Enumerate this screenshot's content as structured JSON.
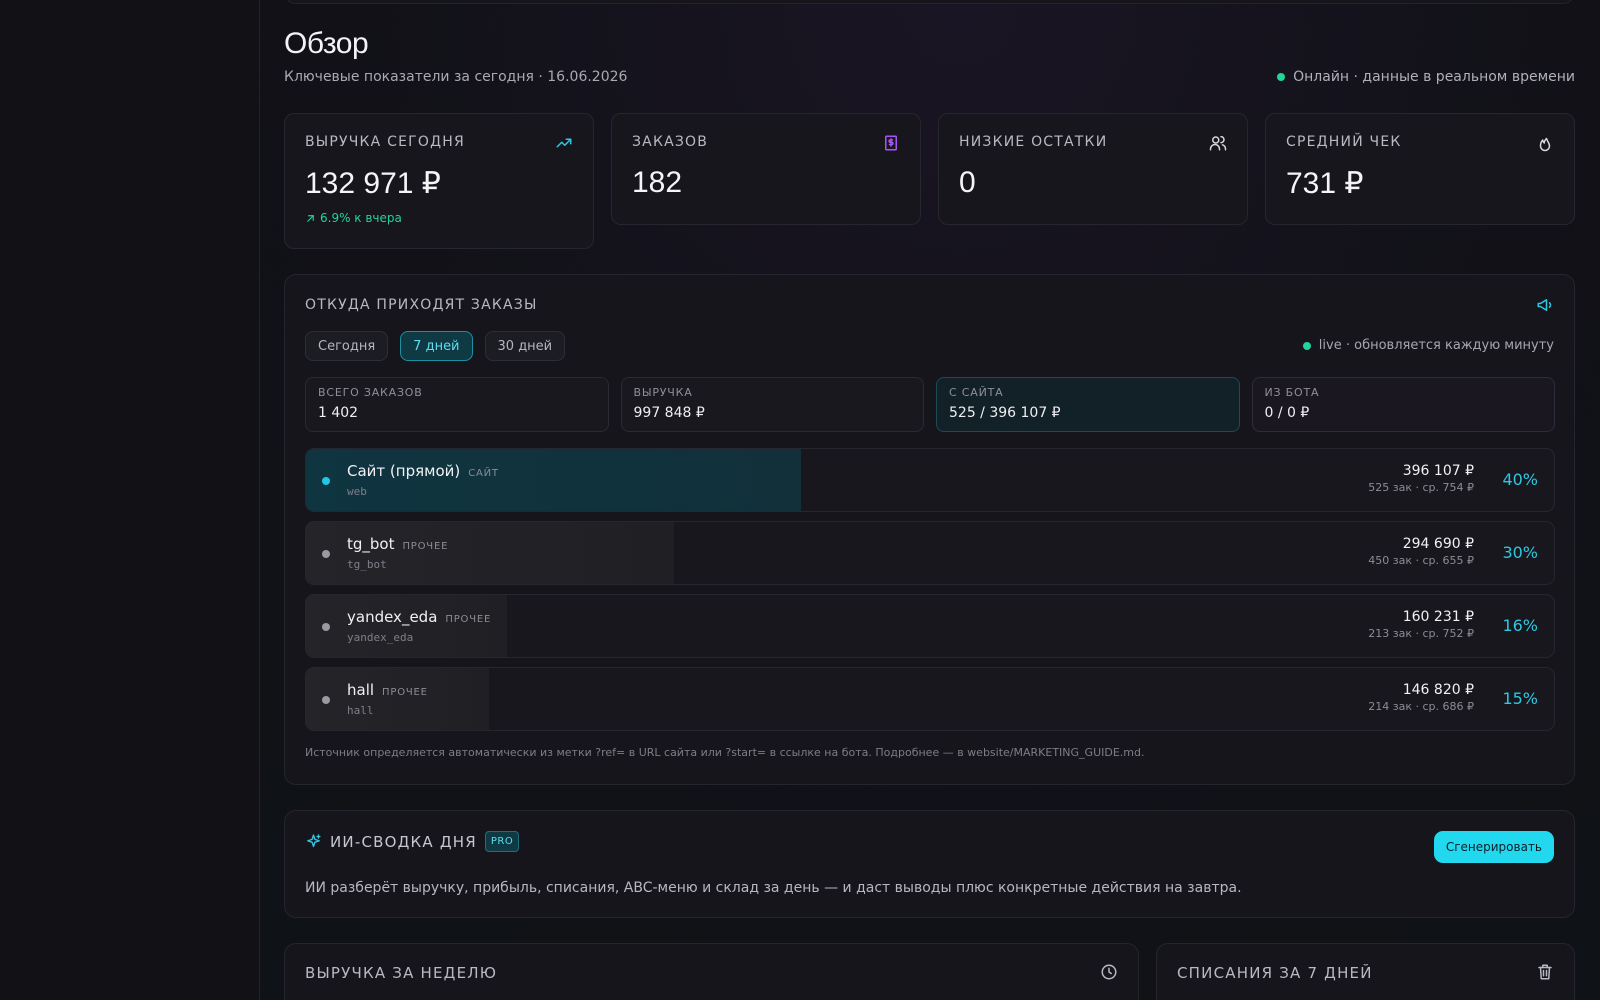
{
  "header": {
    "title": "Обзор",
    "subtitle": "Ключевые показатели за сегодня · 16.06.2026",
    "online_status": "Онлайн · данные в реальном времени"
  },
  "kpis": [
    {
      "label": "ВЫРУЧКА СЕГОДНЯ",
      "value": "132 971 ₽",
      "delta": "6.9% к вчера",
      "icon": "trending-up-icon"
    },
    {
      "label": "ЗАКАЗОВ",
      "value": "182",
      "icon": "receipt-icon"
    },
    {
      "label": "НИЗКИЕ ОСТАТКИ",
      "value": "0",
      "icon": "users-icon"
    },
    {
      "label": "СРЕДНИЙ ЧЕК",
      "value": "731 ₽",
      "icon": "flame-icon"
    }
  ],
  "sources": {
    "title": "ОТКУДА ПРИХОДЯТ ЗАКАЗЫ",
    "tabs": [
      {
        "label": "Сегодня",
        "active": false
      },
      {
        "label": "7 дней",
        "active": true
      },
      {
        "label": "30 дней",
        "active": false
      }
    ],
    "live": "live · обновляется каждую минуту",
    "stats": [
      {
        "label": "ВСЕГО ЗАКАЗОВ",
        "value": "1 402"
      },
      {
        "label": "ВЫРУЧКА",
        "value": "997 848 ₽"
      },
      {
        "label": "С САЙТА",
        "value": "525 / 396 107 ₽"
      },
      {
        "label": "ИЗ БОТА",
        "value": "0 / 0 ₽"
      }
    ],
    "rows": [
      {
        "name": "Сайт (прямой)",
        "tag": "САЙТ",
        "code": "web",
        "amount": "396 107 ₽",
        "meta": "525 зак · ср. 754 ₽",
        "pct": "40%",
        "share": 0.397
      },
      {
        "name": "tg_bot",
        "tag": "ПРОЧЕЕ",
        "code": "tg_bot",
        "amount": "294 690 ₽",
        "meta": "450 зак · ср. 655 ₽",
        "pct": "30%",
        "share": 0.295
      },
      {
        "name": "yandex_eda",
        "tag": "ПРОЧЕЕ",
        "code": "yandex_eda",
        "amount": "160 231 ₽",
        "meta": "213 зак · ср. 752 ₽",
        "pct": "16%",
        "share": 0.161
      },
      {
        "name": "hall",
        "tag": "ПРОЧЕЕ",
        "code": "hall",
        "amount": "146 820 ₽",
        "meta": "214 зак · ср. 686 ₽",
        "pct": "15%",
        "share": 0.147
      }
    ],
    "note": "Источник определяется автоматически из метки ?ref= в URL сайта или ?start= в ссылке на бота. Подробнее — в website/MARKETING_GUIDE.md."
  },
  "ai_summary": {
    "title": "ИИ-СВОДКА ДНЯ",
    "badge": "PRO",
    "button": "Сгенерировать",
    "text": "ИИ разберёт выручку, прибыль, списания, ABC-меню и склад за день — и даст выводы плюс конкретные действия на завтра."
  },
  "week_revenue": {
    "title": "ВЫРУЧКА ЗА НЕДЕЛЮ",
    "icon": "clock-icon"
  },
  "writeoffs": {
    "title": "СПИСАНИЯ ЗА 7 ДНЕЙ",
    "icon": "trash-icon"
  },
  "colors": {
    "accent": "#22d8ef",
    "positive": "#22d39a",
    "bot_icon": "#a855f7"
  }
}
